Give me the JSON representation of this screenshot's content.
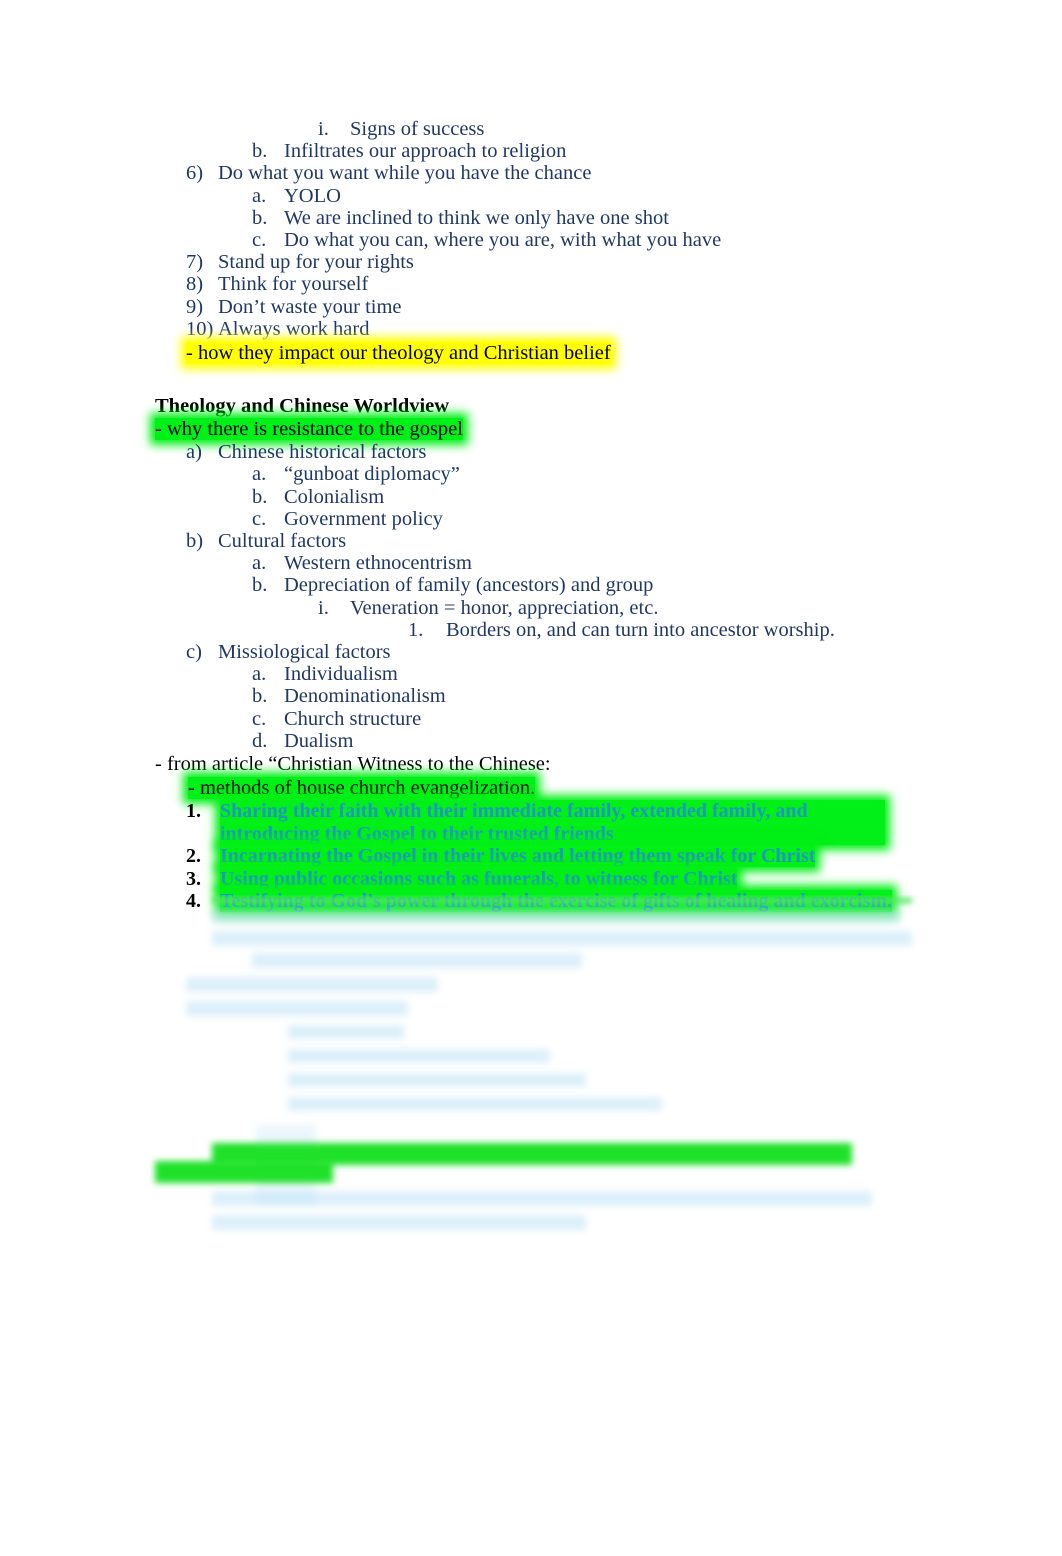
{
  "document": {
    "page_background": "#ffffff",
    "body_text_color": "#1F3864",
    "highlight_yellow": "#FFFF00",
    "highlight_green": "#00F017",
    "teal_text_color": "#1F97C1",
    "black_text_color": "#000000"
  },
  "outline_top": [
    {
      "level": 3,
      "marker": "i.",
      "text": "Signs of success"
    },
    {
      "level": 2,
      "marker": "b.",
      "text": "Infiltrates our approach to religion"
    },
    {
      "level": 1,
      "marker": "6)",
      "text": "Do what you want while you have the chance"
    },
    {
      "level": 2,
      "marker": "a.",
      "text": "YOLO"
    },
    {
      "level": 2,
      "marker": "b.",
      "text": "We are inclined to think we only have one shot"
    },
    {
      "level": 2,
      "marker": "c.",
      "text": "Do what you can, where you are, with what you have"
    },
    {
      "level": 1,
      "marker": "7)",
      "text": "Stand up for your rights"
    },
    {
      "level": 1,
      "marker": "8)",
      "text": "Think for yourself"
    },
    {
      "level": 1,
      "marker": "9)",
      "text": "Don’t waste your time"
    },
    {
      "level": 1,
      "marker": "10)",
      "text": "Always work hard"
    }
  ],
  "impact_note": {
    "text": "- how they impact our theology and Christian belief",
    "highlight": "yellow"
  },
  "section": {
    "heading": "Theology and Chinese Worldview",
    "subtitle": "- why there is resistance to the gospel",
    "subtitle_highlight": "green"
  },
  "outline_factors": [
    {
      "level": 1,
      "marker": "a)",
      "text": "Chinese historical factors"
    },
    {
      "level": 2,
      "marker": "a.",
      "text": "“gunboat diplomacy”"
    },
    {
      "level": 2,
      "marker": "b.",
      "text": "Colonialism"
    },
    {
      "level": 2,
      "marker": "c.",
      "text": "Government policy"
    },
    {
      "level": 1,
      "marker": "b)",
      "text": "Cultural factors"
    },
    {
      "level": 2,
      "marker": "a.",
      "text": "Western ethnocentrism"
    },
    {
      "level": 2,
      "marker": "b.",
      "text": "Depreciation of family (ancestors) and group"
    },
    {
      "level": 3,
      "marker": "i.",
      "text": "Veneration = honor, appreciation, etc."
    },
    {
      "level": 4,
      "marker": "1.",
      "text": "Borders on, and can turn into ancestor worship."
    },
    {
      "level": 1,
      "marker": "c)",
      "text": "Missiological factors"
    },
    {
      "level": 2,
      "marker": "a.",
      "text": "Individualism"
    },
    {
      "level": 2,
      "marker": "b.",
      "text": "Denominationalism"
    },
    {
      "level": 2,
      "marker": "c.",
      "text": "Church structure"
    },
    {
      "level": 2,
      "marker": "d.",
      "text": "Dualism"
    }
  ],
  "article": {
    "source_line": "- from article “Christian Witness to the Chinese:",
    "sub_line": "- methods of house church   evangelization.",
    "sub_line_highlight": "green",
    "methods": [
      {
        "number": "1.",
        "text": "Sharing their faith with their immediate family, extended family, and introducing the Gospel to their trusted friends"
      },
      {
        "number": "2.",
        "text": "Incarnating the Gospel in their lives and letting them speak for Christ"
      },
      {
        "number": "3.",
        "text": "Using public occasions such as funerals, to witness for Christ"
      },
      {
        "number": "4.",
        "text": "Testifying to God’s power through the exercise of gifts of healing and exorcism."
      }
    ]
  },
  "faded_region": {
    "description": "Illegible faded text fading to near-white; content not readable in the screenshot.",
    "ghost_lines": [
      {
        "indent": 1,
        "width_chars": 74
      },
      {
        "indent": 1,
        "width_chars": 76
      },
      {
        "indent": 2,
        "width_chars": 38
      },
      {
        "indent": 1,
        "width_chars": 27
      },
      {
        "indent": 1,
        "width_chars": 24
      },
      {
        "indent": 3,
        "width_chars": 14
      },
      {
        "indent": 3,
        "width_chars": 30
      },
      {
        "indent": 3,
        "width_chars": 34
      },
      {
        "indent": 3,
        "width_chars": 45
      },
      {
        "indent": 1,
        "width_chars": 62
      },
      {
        "indent": 0,
        "width_chars": 13
      },
      {
        "indent": 1,
        "width_chars": 70
      },
      {
        "indent": 1,
        "width_chars": 52
      }
    ]
  }
}
